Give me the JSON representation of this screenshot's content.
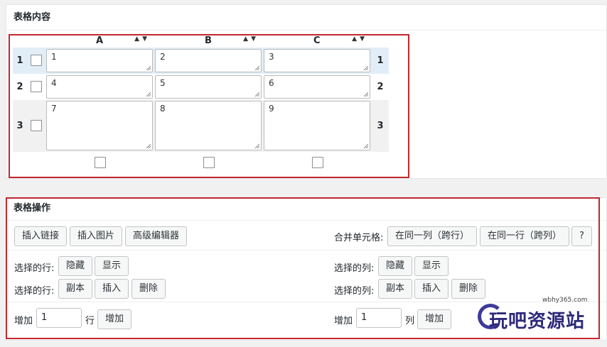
{
  "content_panel": {
    "title": "表格内容",
    "columns": [
      {
        "letter": "A",
        "arrows": "▲▼"
      },
      {
        "letter": "B",
        "arrows": "▲▼"
      },
      {
        "letter": "C",
        "arrows": "▲▼"
      }
    ],
    "rows": [
      {
        "num": "1",
        "cells": [
          "1",
          "2",
          "3"
        ],
        "selected": true
      },
      {
        "num": "2",
        "cells": [
          "4",
          "5",
          "6"
        ],
        "selected": false
      },
      {
        "num": "3",
        "cells": [
          "7",
          "8",
          "9"
        ],
        "selected": false
      }
    ]
  },
  "ops_panel": {
    "title": "表格操作",
    "insert_link": "插入链接",
    "insert_image": "插入图片",
    "advanced_editor": "高级编辑器",
    "merge_label": "合并单元格:",
    "merge_same_col": "在同一列（跨行）",
    "merge_same_row": "在同一行（跨列）",
    "help": "?",
    "selected_rows_label": "选择的行:",
    "selected_cols_label": "选择的列:",
    "hide": "隐藏",
    "show": "显示",
    "duplicate": "副本",
    "insert": "插入",
    "delete": "删除",
    "add_label": "增加",
    "add_rows_value": "1",
    "rows_unit": "行",
    "add_cols_value": "1",
    "cols_unit": "列",
    "add_button": "增加"
  },
  "watermark": {
    "url": "wbhy365.com",
    "text": "玩吧资源站"
  }
}
